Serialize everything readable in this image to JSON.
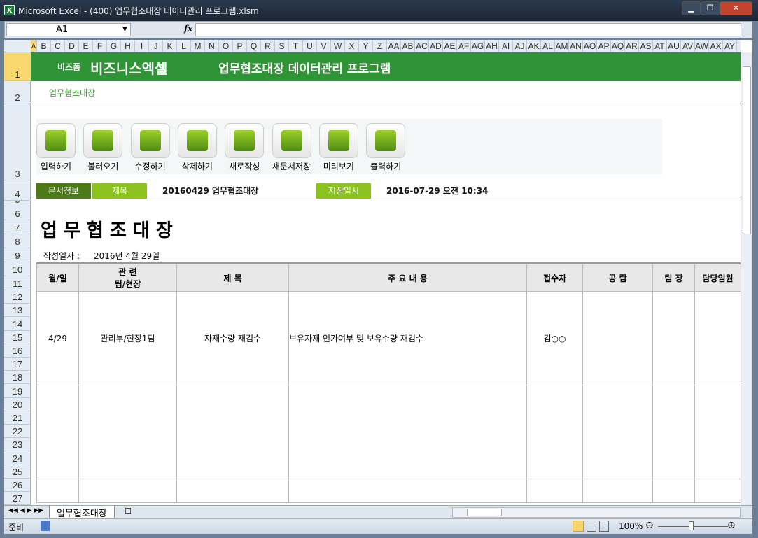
{
  "window": {
    "title": "Microsoft Excel - (400) 업무협조대장 데이터관리 프로그램.xlsm",
    "minimize": "▁",
    "maximize": "❐",
    "close": "✕"
  },
  "formula_bar": {
    "name_box": "A1",
    "fx": "fx",
    "value": ""
  },
  "columns": [
    "A",
    "B",
    "C",
    "D",
    "E",
    "F",
    "G",
    "H",
    "I",
    "J",
    "K",
    "L",
    "M",
    "N",
    "O",
    "P",
    "Q",
    "R",
    "S",
    "T",
    "U",
    "V",
    "W",
    "X",
    "Y",
    "Z",
    "AA",
    "AB",
    "AC",
    "AD",
    "AE",
    "AF",
    "AG",
    "AH",
    "AI",
    "AJ",
    "AK",
    "AL",
    "AM",
    "AN",
    "AO",
    "AP",
    "AQ",
    "AR",
    "AS",
    "AT",
    "AU",
    "AV",
    "AW",
    "AX",
    "AY",
    "A"
  ],
  "rows": [
    "1",
    "2",
    "3",
    "4",
    "5",
    "6",
    "7",
    "8",
    "9",
    "10",
    "11",
    "12",
    "13",
    "14",
    "15",
    "16",
    "17",
    "18",
    "19",
    "20",
    "21",
    "22",
    "23",
    "24",
    "25",
    "26",
    "27"
  ],
  "header": {
    "brand_small": "비즈폼",
    "brand": "비즈니스엑셀",
    "program_title": "업무협조대장 데이터관리 프로그램",
    "subtitle": "업무협조대장"
  },
  "toolbar": [
    "입력하기",
    "불러오기",
    "수정하기",
    "삭제하기",
    "새로작성",
    "새문서저장",
    "미리보기",
    "출력하기"
  ],
  "doc_info": {
    "label": "문서정보",
    "title_label": "제목",
    "title_value": "20160429 업무협조대장",
    "saved_label": "저장일시",
    "saved_value": "2016-07-29  오전 10:34"
  },
  "form": {
    "title": "업 무 협 조 대 장",
    "date_label": "작성일자 :",
    "date_value": "2016년 4월 29일"
  },
  "table": {
    "headers": [
      "월/일",
      "관  련\n팀/현장",
      "제    목",
      "주     요     내     용",
      "접수자",
      "공 람",
      "팀 장",
      "담당임원"
    ],
    "rows": [
      [
        "4/29",
        "관리부/현장1팀",
        "자재수량 재검수",
        "보유자재 인가여부 및 보유수량 재검수",
        "김○○",
        "",
        "",
        ""
      ],
      [
        "",
        "",
        "",
        "",
        "",
        "",
        "",
        ""
      ],
      [
        "",
        "",
        "",
        "",
        "",
        "",
        "",
        ""
      ]
    ]
  },
  "sheet_tab": "업무협조대장",
  "status": {
    "ready": "준비",
    "zoom": "100%"
  }
}
